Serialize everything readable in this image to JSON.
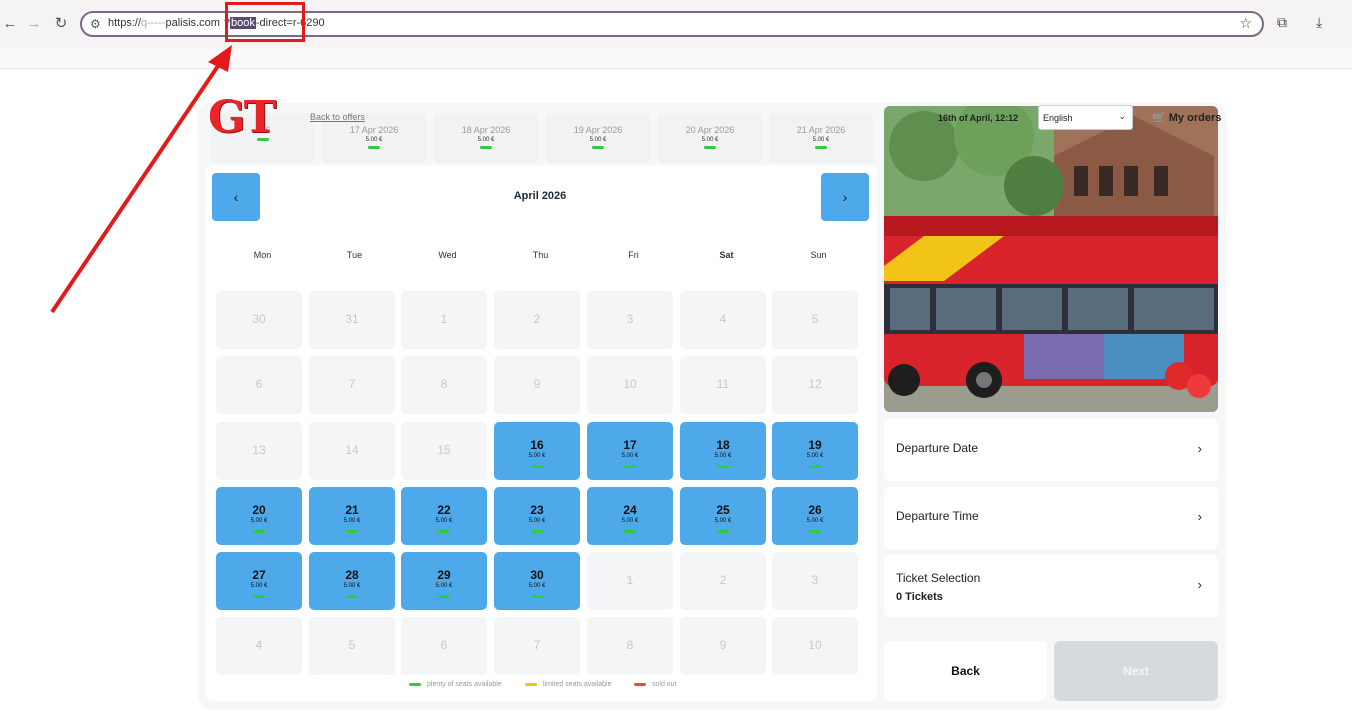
{
  "browser": {
    "url_prefix": "https://",
    "url_host_blur": "q-----",
    "url_host": "palisis.com",
    "url_q": "?",
    "url_highlight": "book",
    "url_suffix": "-direct=r-6290"
  },
  "overlay": {
    "logo_text": "GT"
  },
  "booking": {
    "back_to_offers": "Back to offers",
    "strip": [
      {
        "date": "026",
        "price": ""
      },
      {
        "date": "17 Apr 2026",
        "price": "5.00 €"
      },
      {
        "date": "18 Apr 2026",
        "price": "5.00 €"
      },
      {
        "date": "19 Apr 2026",
        "price": "5.00 €"
      },
      {
        "date": "20 Apr 2026",
        "price": "5.00 €"
      },
      {
        "date": "21 Apr 2026",
        "price": "5.00 €"
      }
    ],
    "prev_icon": "chevron-left-icon",
    "next_icon": "chevron-right-icon",
    "month": "April 2026",
    "weekdays": [
      "Mon",
      "Tue",
      "Wed",
      "Thu",
      "Fri",
      "Sat",
      "Sun"
    ],
    "weeks": [
      [
        {
          "n": "30"
        },
        {
          "n": "31"
        },
        {
          "n": "1"
        },
        {
          "n": "2"
        },
        {
          "n": "3"
        },
        {
          "n": "4"
        },
        {
          "n": "5"
        }
      ],
      [
        {
          "n": "6"
        },
        {
          "n": "7"
        },
        {
          "n": "8"
        },
        {
          "n": "9"
        },
        {
          "n": "10"
        },
        {
          "n": "11"
        },
        {
          "n": "12"
        }
      ],
      [
        {
          "n": "13"
        },
        {
          "n": "14"
        },
        {
          "n": "15"
        },
        {
          "n": "16",
          "p": "5.00 €"
        },
        {
          "n": "17",
          "p": "5.00 €"
        },
        {
          "n": "18",
          "p": "5.00 €"
        },
        {
          "n": "19",
          "p": "5.00 €"
        }
      ],
      [
        {
          "n": "20",
          "p": "5.00 €"
        },
        {
          "n": "21",
          "p": "5.00 €"
        },
        {
          "n": "22",
          "p": "5.00 €"
        },
        {
          "n": "23",
          "p": "5.00 €"
        },
        {
          "n": "24",
          "p": "5.00 €"
        },
        {
          "n": "25",
          "p": "5.00 €"
        },
        {
          "n": "26",
          "p": "5.00 €"
        }
      ],
      [
        {
          "n": "27",
          "p": "5.00 €"
        },
        {
          "n": "28",
          "p": "5.00 €"
        },
        {
          "n": "29",
          "p": "5.00 €"
        },
        {
          "n": "30",
          "p": "5.00 €"
        },
        {
          "n": "1"
        },
        {
          "n": "2"
        },
        {
          "n": "3"
        }
      ],
      [
        {
          "n": "4"
        },
        {
          "n": "5"
        },
        {
          "n": "6"
        },
        {
          "n": "7"
        },
        {
          "n": "8"
        },
        {
          "n": "9"
        },
        {
          "n": "10"
        }
      ]
    ],
    "legend": [
      {
        "label": "plenty of seats available",
        "color": "#2ecc40"
      },
      {
        "label": "limited seats available",
        "color": "#f1c40f"
      },
      {
        "label": "sold out",
        "color": "#e74c3c"
      }
    ],
    "header": {
      "date_time": "16th of April, 12:12",
      "language": "English",
      "orders": "My orders"
    },
    "steps": {
      "departure_date": "Departure Date",
      "departure_time": "Departure Time",
      "ticket_selection": "Ticket Selection",
      "tickets_count": "0 Tickets"
    },
    "buttons": {
      "back": "Back",
      "next": "Next"
    }
  },
  "colors": {
    "available": "#4ea9ea",
    "accent_red": "#e31a1a"
  }
}
